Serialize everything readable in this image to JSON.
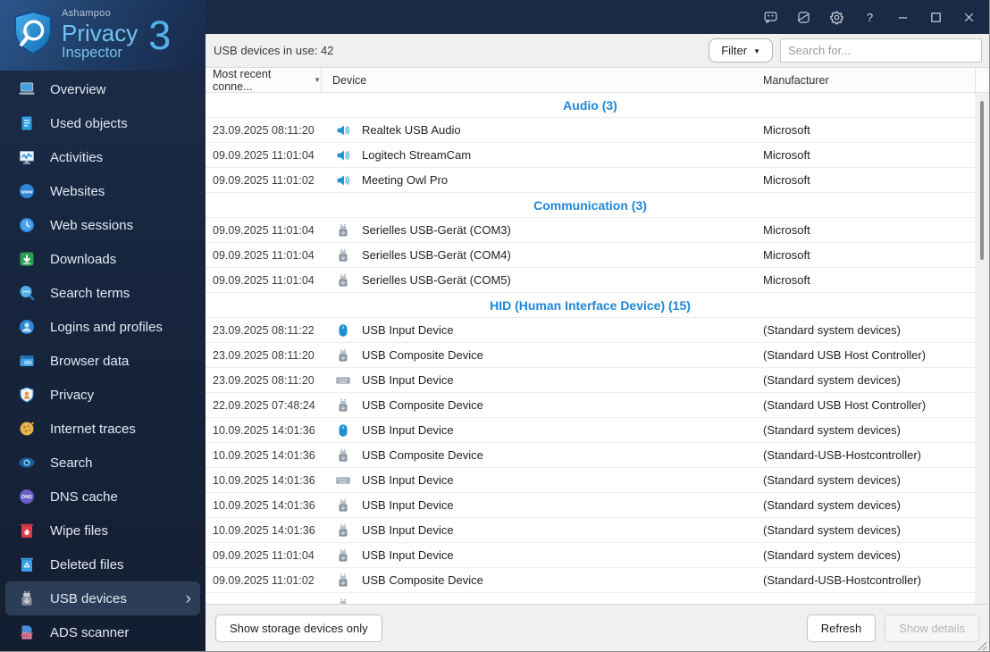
{
  "colors": {
    "sidebar_bg": "#17263f",
    "titlebar_bg": "#1b2a44",
    "selected_item_bg": "#2c3d58",
    "accent_blue": "#1e87d5",
    "logo_blue": "#72c3f1",
    "toolbar_bg": "#f0f0f1"
  },
  "logo": {
    "brand": "Ashampoo",
    "product_line1": "Privacy",
    "product_line2": "Inspector",
    "version": "3"
  },
  "titlebar": {
    "icons": [
      {
        "name": "feedback-icon"
      },
      {
        "name": "theme-icon"
      },
      {
        "name": "settings-gear-icon"
      },
      {
        "name": "help-icon"
      },
      {
        "name": "minimize-icon"
      },
      {
        "name": "maximize-icon"
      },
      {
        "name": "close-icon"
      }
    ]
  },
  "sidebar": {
    "items": [
      {
        "label": "Overview",
        "icon": "laptop-icon",
        "selected": false
      },
      {
        "label": "Used objects",
        "icon": "document-icon",
        "selected": false
      },
      {
        "label": "Activities",
        "icon": "activity-monitor-icon",
        "selected": false
      },
      {
        "label": "Websites",
        "icon": "www-globe-icon",
        "selected": false
      },
      {
        "label": "Web sessions",
        "icon": "clock-icon",
        "selected": false
      },
      {
        "label": "Downloads",
        "icon": "download-icon",
        "selected": false
      },
      {
        "label": "Search terms",
        "icon": "search-bubble-icon",
        "selected": false
      },
      {
        "label": "Logins and profiles",
        "icon": "user-icon",
        "selected": false
      },
      {
        "label": "Browser data",
        "icon": "browser-window-icon",
        "selected": false
      },
      {
        "label": "Privacy",
        "icon": "privacy-shield-icon",
        "selected": false
      },
      {
        "label": "Internet traces",
        "icon": "cookie-icon",
        "selected": false
      },
      {
        "label": "Search",
        "icon": "eye-icon",
        "selected": false
      },
      {
        "label": "DNS cache",
        "icon": "dns-icon",
        "selected": false
      },
      {
        "label": "Wipe files",
        "icon": "wipe-trash-icon",
        "selected": false
      },
      {
        "label": "Deleted files",
        "icon": "recycle-trash-icon",
        "selected": false
      },
      {
        "label": "USB devices",
        "icon": "usb-stick-icon",
        "selected": true
      },
      {
        "label": "ADS scanner",
        "icon": "ads-file-icon",
        "selected": false
      }
    ]
  },
  "toolbar": {
    "status_text": "USB devices in use: 42",
    "filter_button": "Filter",
    "search_placeholder": "Search for..."
  },
  "table": {
    "columns": [
      {
        "label": "Most recent conne...",
        "sort": "desc"
      },
      {
        "label": "Device"
      },
      {
        "label": "Manufacturer"
      }
    ],
    "groups": [
      {
        "title": "Audio (3)",
        "rows": [
          {
            "date": "23.09.2025 08:11:20",
            "icon": "speaker-icon",
            "device": "Realtek USB Audio",
            "manufacturer": "Microsoft"
          },
          {
            "date": "09.09.2025 11:01:04",
            "icon": "speaker-icon",
            "device": "Logitech StreamCam",
            "manufacturer": "Microsoft"
          },
          {
            "date": "09.09.2025 11:01:02",
            "icon": "speaker-icon",
            "device": "Meeting Owl Pro",
            "manufacturer": "Microsoft"
          }
        ]
      },
      {
        "title": "Communication (3)",
        "rows": [
          {
            "date": "09.09.2025 11:01:04",
            "icon": "usb-plug-icon",
            "device": "Serielles USB-Gerät (COM3)",
            "manufacturer": "Microsoft"
          },
          {
            "date": "09.09.2025 11:01:04",
            "icon": "usb-plug-icon",
            "device": "Serielles USB-Gerät (COM4)",
            "manufacturer": "Microsoft"
          },
          {
            "date": "09.09.2025 11:01:04",
            "icon": "usb-plug-icon",
            "device": "Serielles USB-Gerät (COM5)",
            "manufacturer": "Microsoft"
          }
        ]
      },
      {
        "title": "HID (Human Interface Device) (15)",
        "rows": [
          {
            "date": "23.09.2025 08:11:22",
            "icon": "mouse-icon",
            "device": "USB Input Device",
            "manufacturer": "(Standard system devices)"
          },
          {
            "date": "23.09.2025 08:11:20",
            "icon": "usb-plug-icon",
            "device": "USB Composite Device",
            "manufacturer": "(Standard USB Host Controller)"
          },
          {
            "date": "23.09.2025 08:11:20",
            "icon": "keyboard-icon",
            "device": "USB Input Device",
            "manufacturer": "(Standard system devices)"
          },
          {
            "date": "22.09.2025 07:48:24",
            "icon": "usb-plug-icon",
            "device": "USB Composite Device",
            "manufacturer": "(Standard USB Host Controller)"
          },
          {
            "date": "10.09.2025 14:01:36",
            "icon": "mouse-icon",
            "device": "USB Input Device",
            "manufacturer": "(Standard system devices)"
          },
          {
            "date": "10.09.2025 14:01:36",
            "icon": "usb-plug-icon",
            "device": "USB Composite Device",
            "manufacturer": "(Standard-USB-Hostcontroller)"
          },
          {
            "date": "10.09.2025 14:01:36",
            "icon": "keyboard-icon",
            "device": "USB Input Device",
            "manufacturer": "(Standard system devices)"
          },
          {
            "date": "10.09.2025 14:01:36",
            "icon": "usb-plug-icon",
            "device": "USB Input Device",
            "manufacturer": "(Standard system devices)"
          },
          {
            "date": "10.09.2025 14:01:36",
            "icon": "usb-plug-icon",
            "device": "USB Input Device",
            "manufacturer": "(Standard system devices)"
          },
          {
            "date": "09.09.2025 11:01:04",
            "icon": "usb-plug-icon",
            "device": "USB Input Device",
            "manufacturer": "(Standard system devices)"
          },
          {
            "date": "09.09.2025 11:01:02",
            "icon": "usb-plug-icon",
            "device": "USB Composite Device",
            "manufacturer": "(Standard-USB-Hostcontroller)"
          },
          {
            "date": "",
            "icon": "usb-plug-icon",
            "device": "",
            "manufacturer": "",
            "partial": true
          }
        ]
      }
    ]
  },
  "footer": {
    "storage_button": "Show storage devices only",
    "refresh_button": "Refresh",
    "details_button": "Show details"
  }
}
